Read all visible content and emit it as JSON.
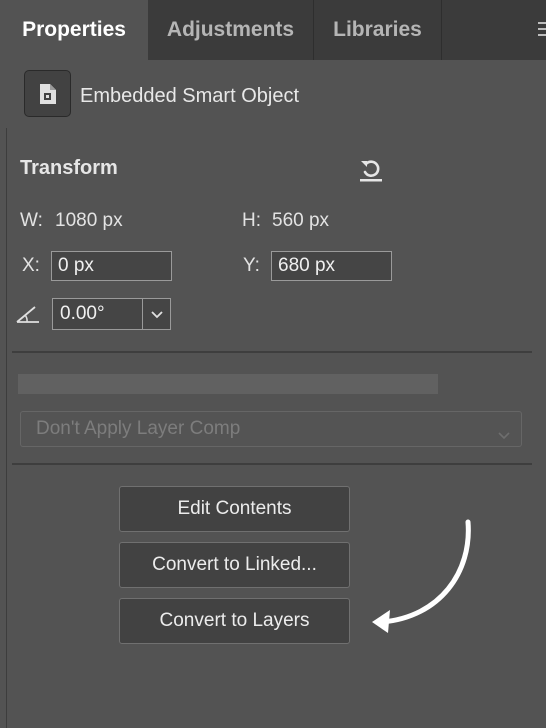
{
  "tabs": [
    {
      "label": "Properties",
      "active": true
    },
    {
      "label": "Adjustments",
      "active": false
    },
    {
      "label": "Libraries",
      "active": false
    }
  ],
  "panel_menu_icon": "hamburger-icon",
  "object": {
    "icon": "smart-object-icon",
    "label": "Embedded Smart Object"
  },
  "transform": {
    "title": "Transform",
    "reset_icon": "reset-icon",
    "w_label": "W:",
    "w_value": "1080 px",
    "h_label": "H:",
    "h_value": "560 px",
    "x_label": "X:",
    "x_value": "0 px",
    "y_label": "Y:",
    "y_value": "680 px",
    "angle_icon": "angle-icon",
    "angle_value": "0.00°"
  },
  "layer_comp": {
    "selected": "Don't Apply Layer Comp"
  },
  "buttons": {
    "edit_contents": "Edit Contents",
    "convert_linked": "Convert to Linked...",
    "convert_layers": "Convert to Layers"
  },
  "annotation": {
    "arrow_icon": "curved-arrow-icon",
    "color": "#ffffff"
  },
  "colors": {
    "panel_bg": "#535353",
    "tabbar_bg": "#3b3b3b",
    "button_bg": "#424242"
  }
}
